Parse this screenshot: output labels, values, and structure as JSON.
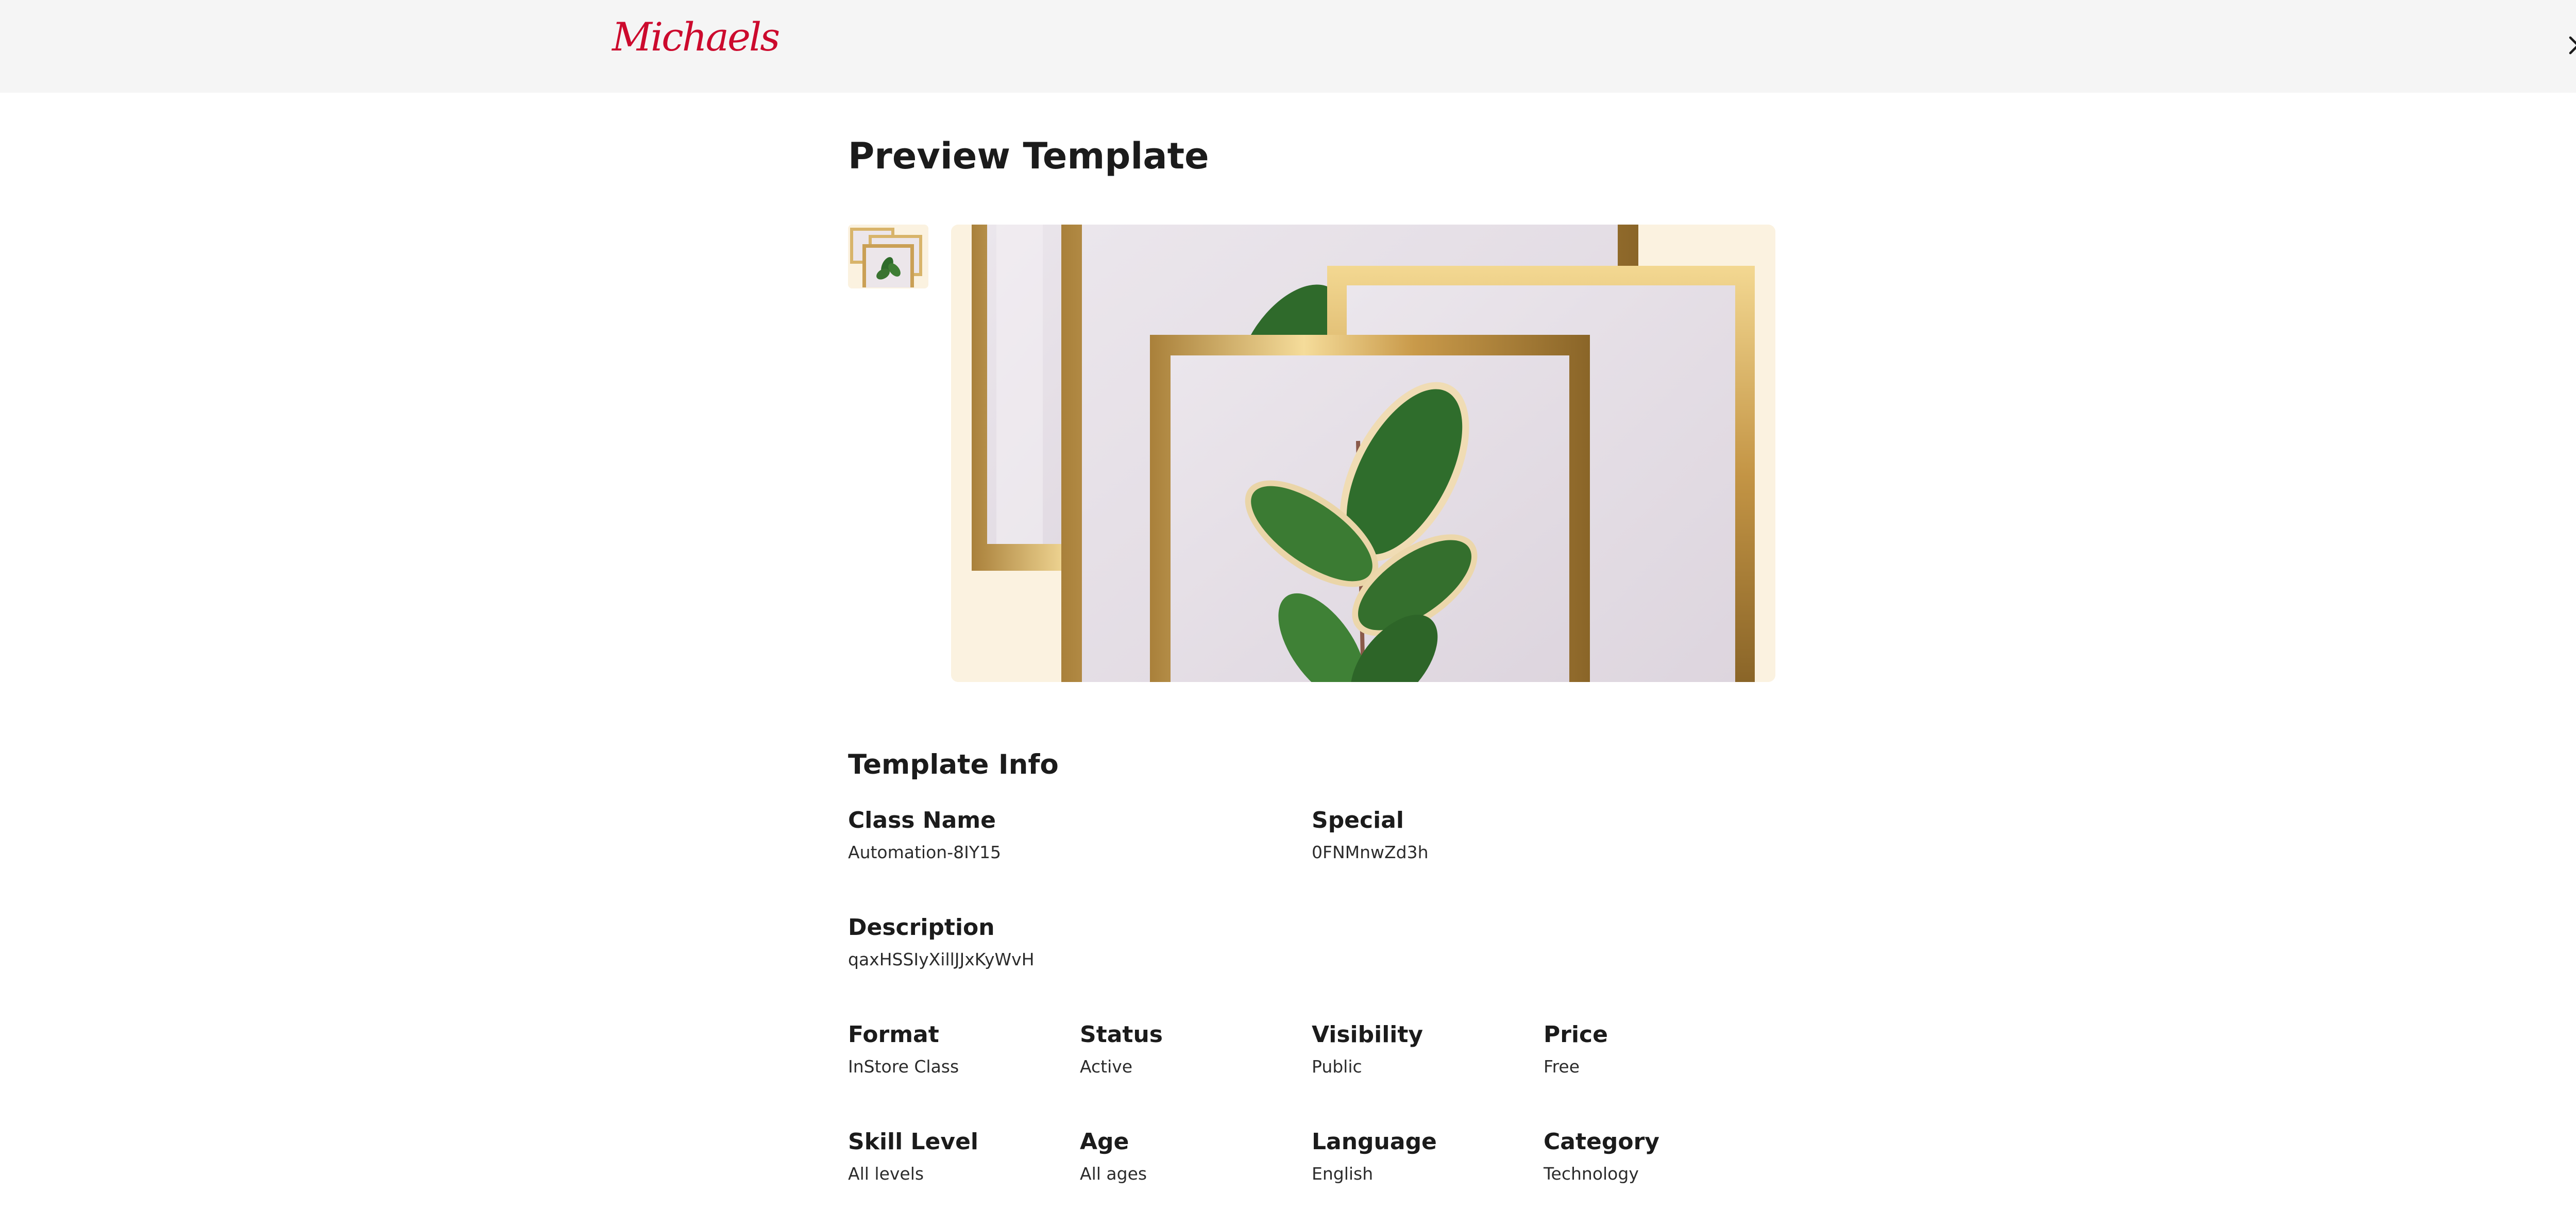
{
  "header": {
    "logo_text": "Michaels",
    "brand_color": "#cc0a2d",
    "close_icon": "close-icon"
  },
  "page": {
    "title": "Preview Template"
  },
  "gallery": {
    "thumbnail_icon": "framed-plant-image",
    "main_image_icon": "framed-plant-image"
  },
  "template_info": {
    "heading": "Template Info",
    "class_name": {
      "label": "Class Name",
      "value": "Automation-8IY15"
    },
    "special": {
      "label": "Special",
      "value": "0FNMnwZd3h"
    },
    "description": {
      "label": "Description",
      "value": "qaxHSSIyXillJJxKyWvH"
    },
    "format": {
      "label": "Format",
      "value": "InStore Class"
    },
    "status": {
      "label": "Status",
      "value": "Active"
    },
    "visibility": {
      "label": "Visibility",
      "value": "Public"
    },
    "price": {
      "label": "Price",
      "value": "Free"
    },
    "skill_level": {
      "label": "Skill Level",
      "value": "All levels"
    },
    "age": {
      "label": "Age",
      "value": "All ages"
    },
    "language": {
      "label": "Language",
      "value": "English"
    },
    "category": {
      "label": "Category",
      "value": "Technology"
    }
  }
}
